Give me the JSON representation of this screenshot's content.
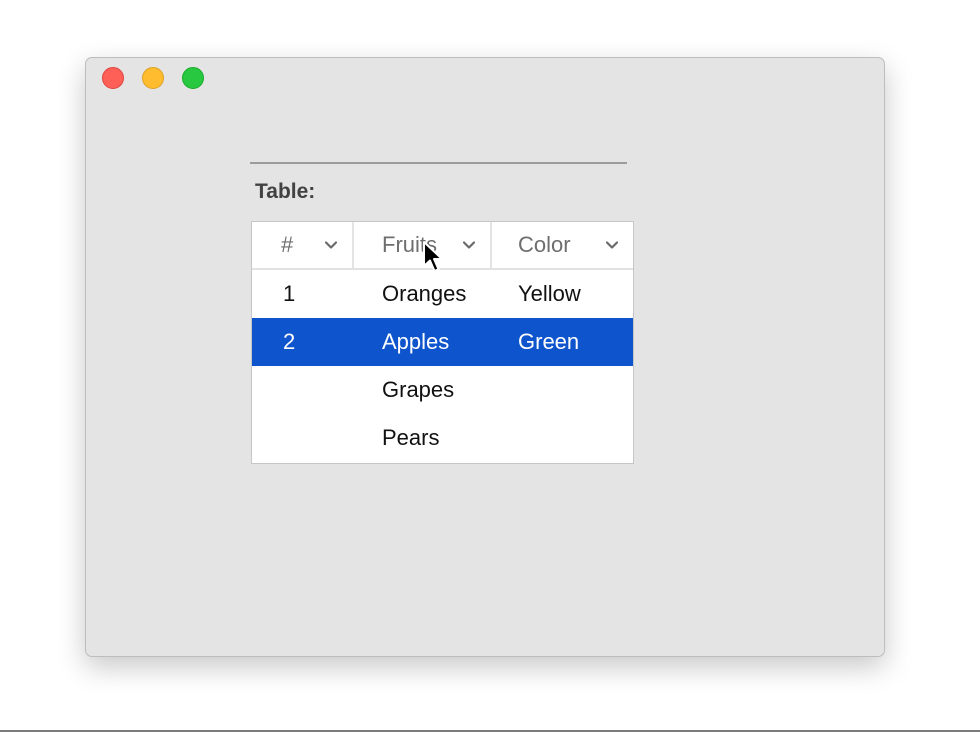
{
  "window": {
    "traffic_lights": [
      "close",
      "minimize",
      "zoom"
    ],
    "colors": {
      "close": "#fe5f57",
      "minimize": "#febc2e",
      "zoom": "#28c840"
    }
  },
  "table_label": "Table:",
  "table": {
    "columns": [
      {
        "label": "#",
        "icon": "chevron-down-icon"
      },
      {
        "label": "Fruits",
        "icon": "chevron-down-icon"
      },
      {
        "label": "Color",
        "icon": "chevron-down-icon"
      }
    ],
    "rows": [
      {
        "num": "1",
        "fruit": "Oranges",
        "color": "Yellow",
        "selected": false
      },
      {
        "num": "2",
        "fruit": "Apples",
        "color": "Green",
        "selected": true
      },
      {
        "num": "",
        "fruit": "Grapes",
        "color": "",
        "selected": false
      },
      {
        "num": "",
        "fruit": "Pears",
        "color": "",
        "selected": false
      }
    ],
    "selection_color": "#0e54cc"
  },
  "cursor": "arrow-pointer-icon"
}
